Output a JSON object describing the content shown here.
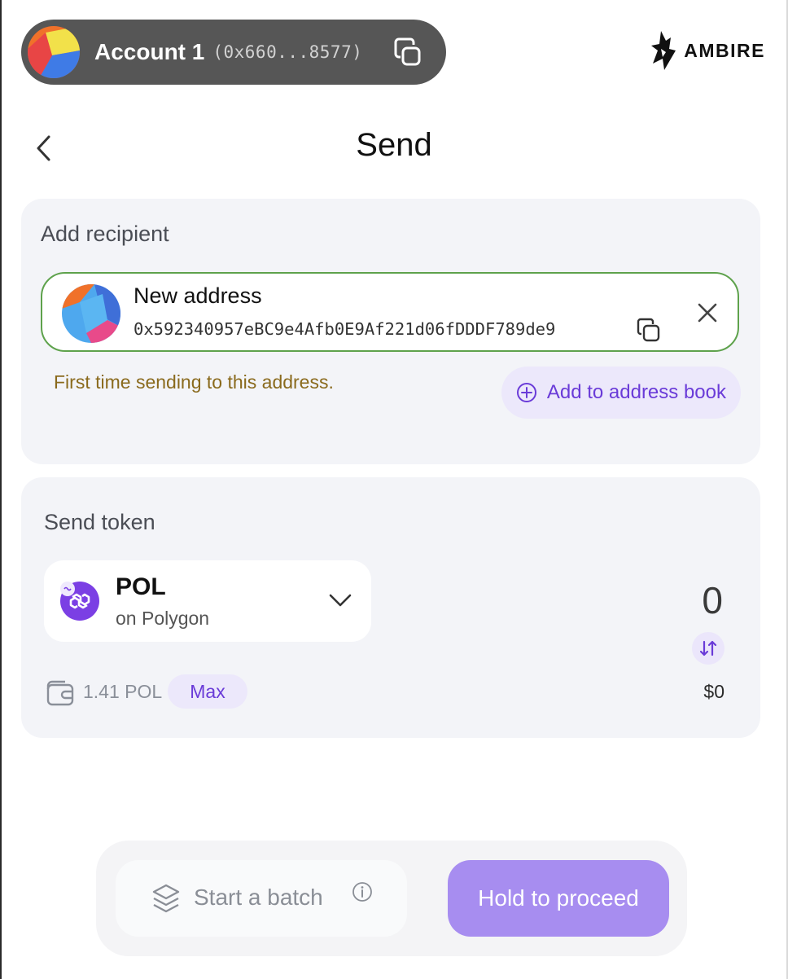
{
  "account": {
    "name": "Account 1",
    "address_short": "(0x660...8577)"
  },
  "brand": {
    "name": "AMBIRE"
  },
  "header": {
    "title": "Send"
  },
  "recipient": {
    "section_label": "Add recipient",
    "name": "New address",
    "address": "0x592340957eBC9e4Afb0E9Af221d06fDDDF789de9",
    "warning": "First time sending to this address.",
    "add_to_book_label": "Add to address book",
    "border_color": "#5ea24c"
  },
  "token": {
    "section_label": "Send token",
    "symbol": "POL",
    "network": "on Polygon",
    "amount": "0",
    "usd_value": "$0",
    "balance": "1.41 POL",
    "max_label": "Max",
    "icon_color": "#7b3fe4"
  },
  "actions": {
    "batch_label": "Start a batch",
    "proceed_label": "Hold to proceed",
    "proceed_color": "#a78df0"
  },
  "icons": {
    "copy": "copy-icon",
    "back": "chevron-left-icon",
    "close": "close-icon",
    "add": "plus-circle-icon",
    "dropdown": "chevron-down-icon",
    "swap": "swap-vertical-icon",
    "wallet": "wallet-icon",
    "layers": "layers-icon",
    "info": "info-icon"
  }
}
